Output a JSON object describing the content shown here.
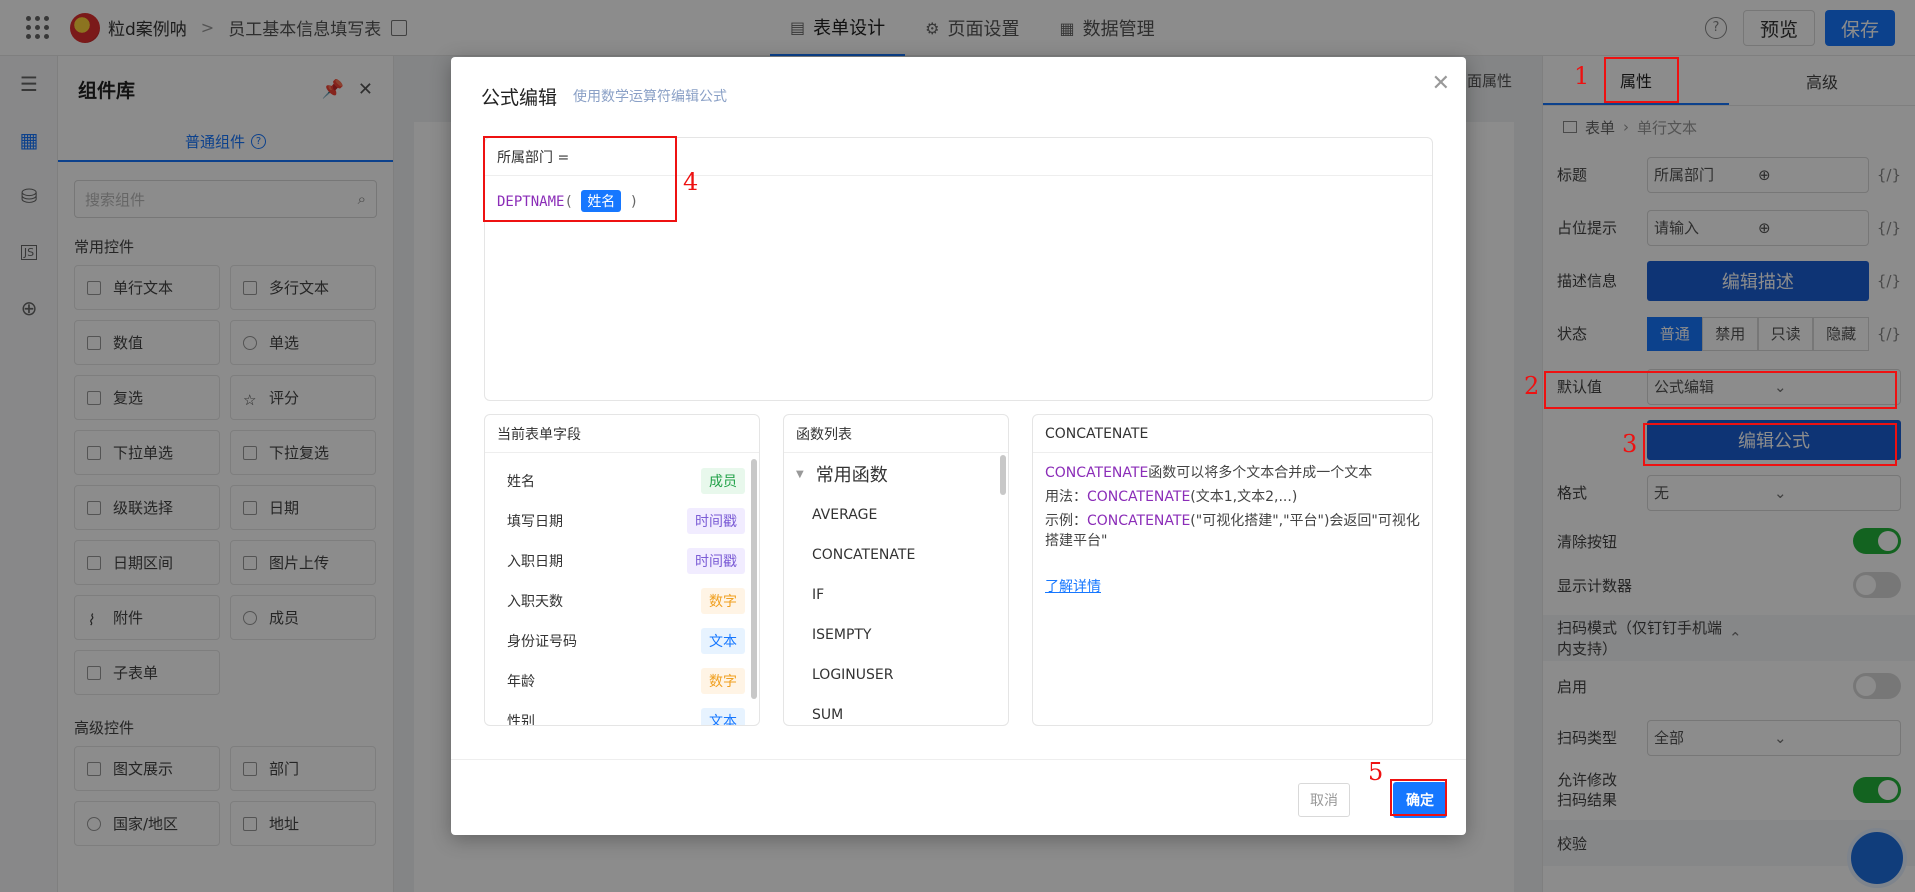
{
  "topbar": {
    "app_name": "粒d案例呐",
    "separator": ">",
    "form_name": "员工基本信息填写表",
    "tabs": [
      {
        "label": "表单设计",
        "icon": "document-icon"
      },
      {
        "label": "页面设置",
        "icon": "gear-icon"
      },
      {
        "label": "数据管理",
        "icon": "table-icon"
      }
    ],
    "help": "?",
    "preview_label": "预览",
    "save_label": "保存"
  },
  "library": {
    "title": "组件库",
    "tab": "普通组件",
    "search_placeholder": "搜索组件",
    "common_group": "常用控件",
    "common_items": [
      "单行文本",
      "多行文本",
      "数值",
      "单选",
      "复选",
      "评分",
      "下拉单选",
      "下拉复选",
      "级联选择",
      "日期",
      "日期区间",
      "图片上传",
      "附件",
      "成员",
      "子表单"
    ],
    "advanced_group": "高级控件",
    "advanced_items": [
      "图文展示",
      "部门",
      "国家/地区",
      "地址"
    ]
  },
  "canvas": {
    "top_label": "页面属性"
  },
  "right": {
    "tabs": [
      "属性",
      "高级"
    ],
    "breadcrumb": [
      "表单",
      "单行文本"
    ],
    "title_label": "标题",
    "title_value": "所属部门",
    "placeholder_label": "占位提示",
    "placeholder_value": "请输入",
    "desc_label": "描述信息",
    "desc_button": "编辑描述",
    "expr_icon": "{/}",
    "state_label": "状态",
    "state_options": [
      "普通",
      "禁用",
      "只读",
      "隐藏"
    ],
    "default_label": "默认值",
    "default_value": "公式编辑",
    "edit_formula": "编辑公式",
    "format_label": "格式",
    "format_value": "无",
    "clear_label": "清除按钮",
    "counter_label": "显示计数器",
    "scan_section": "扫码模式（仅钉钉手机端内支持）",
    "enable_label": "启用",
    "scan_type_label": "扫码类型",
    "scan_type_value": "全部",
    "allow_edit_label_1": "允许修改",
    "allow_edit_label_2": "扫码结果",
    "validate_section": "校验"
  },
  "modal": {
    "title": "公式编辑",
    "subtitle": "使用数学运算符编辑公式",
    "field_header": "所属部门 =",
    "formula_fn": "DEPTNAME",
    "formula_open": "(",
    "formula_arg": "姓名",
    "formula_close": ")",
    "fields_title": "当前表单字段",
    "fields": [
      {
        "name": "姓名",
        "type": "成员"
      },
      {
        "name": "填写日期",
        "type": "时间戳"
      },
      {
        "name": "入职日期",
        "type": "时间戳"
      },
      {
        "name": "入职天数",
        "type": "数字"
      },
      {
        "name": "身份证号码",
        "type": "文本"
      },
      {
        "name": "年龄",
        "type": "数字"
      },
      {
        "name": "性别",
        "type": "文本"
      }
    ],
    "funcs_title": "函数列表",
    "func_group": "常用函数",
    "funcs": [
      "AVERAGE",
      "CONCATENATE",
      "IF",
      "ISEMPTY",
      "LOGINUSER",
      "SUM"
    ],
    "desc_title": "CONCATENATE",
    "desc_fn": "CONCATENATE",
    "desc_line1": "函数可以将多个文本合并成一个文本",
    "usage_prefix": "用法：",
    "usage_args": "(文本1,文本2,...)",
    "example_prefix": "示例：",
    "example_args": "(\"可视化搭建\",\"平台\")会返回\"可视化搭建平台\"",
    "learn_more": "了解详情",
    "cancel": "取消",
    "ok": "确定"
  },
  "annotations": [
    "1",
    "2",
    "3",
    "4",
    "5"
  ]
}
